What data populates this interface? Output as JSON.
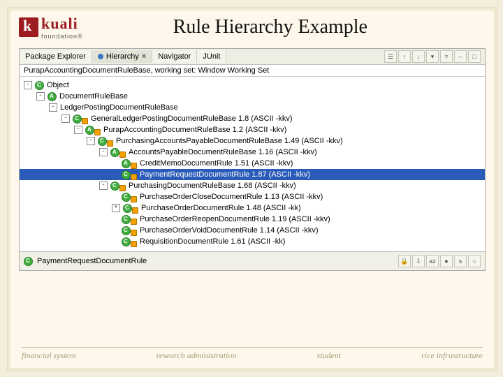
{
  "logo": {
    "word": "kuali",
    "sub": "foundation®"
  },
  "title": "Rule Hierarchy Example",
  "tabs": {
    "items": [
      {
        "label": "Package Explorer",
        "active": false,
        "closable": false
      },
      {
        "label": "Hierarchy",
        "active": true,
        "closable": true
      },
      {
        "label": "Navigator",
        "active": false,
        "closable": false
      },
      {
        "label": "JUnit",
        "active": false,
        "closable": false
      }
    ]
  },
  "path": "PurapAccountingDocumentRuleBase, working set: Window Working Set",
  "tree": [
    {
      "indent": 0,
      "exp": "-",
      "icon": "cls",
      "label": "Object"
    },
    {
      "indent": 1,
      "exp": "-",
      "icon": "clsA",
      "label": "DocumentRuleBase"
    },
    {
      "indent": 2,
      "exp": "-",
      "icon": "none",
      "label": "LedgerPostingDocumentRuleBase"
    },
    {
      "indent": 3,
      "exp": "-",
      "icon": "ov",
      "label": "GeneralLedgerPostingDocumentRuleBase  1.8  (ASCII -kkv)"
    },
    {
      "indent": 4,
      "exp": "-",
      "icon": "clsAov",
      "label": "PurapAccountingDocumentRuleBase  1.2  (ASCII -kkv)"
    },
    {
      "indent": 5,
      "exp": "-",
      "icon": "ov",
      "label": "PurchasingAccountsPayableDocumentRuleBase  1.49  (ASCII -kkv)"
    },
    {
      "indent": 6,
      "exp": "-",
      "icon": "clsAov",
      "label": "AccountsPayableDocumentRuleBase  1.16  (ASCII -kkv)"
    },
    {
      "indent": 7,
      "exp": " ",
      "icon": "clsAov",
      "label": "CreditMemoDocumentRule  1.51  (ASCII -kkv)"
    },
    {
      "indent": 7,
      "exp": " ",
      "icon": "ov",
      "label": "PaymentRequestDocumentRule  1.87  (ASCII -kkv)",
      "selected": true
    },
    {
      "indent": 6,
      "exp": "-",
      "icon": "ov",
      "label": "PurchasingDocumentRuleBase  1.68  (ASCII -kkv)"
    },
    {
      "indent": 7,
      "exp": " ",
      "icon": "ov",
      "label": "PurchaseOrderCloseDocumentRule  1.13  (ASCII -kkv)"
    },
    {
      "indent": 7,
      "exp": "+",
      "icon": "ov",
      "label": "PurchaseOrderDocumentRule  1.48  (ASCII -kk)"
    },
    {
      "indent": 7,
      "exp": " ",
      "icon": "ov",
      "label": "PurchaseOrderReopenDocumentRule  1.19  (ASCII -kkv)"
    },
    {
      "indent": 7,
      "exp": " ",
      "icon": "ov",
      "label": "PurchaseOrderVoidDocumentRule  1.14  (ASCII -kkv)"
    },
    {
      "indent": 7,
      "exp": " ",
      "icon": "ov",
      "label": "RequisitionDocumentRule  1.61  (ASCII -kk)"
    }
  ],
  "selected_summary": "PaymentRequestDocumentRule",
  "footer": {
    "c1": "financial system",
    "c2": "research administration",
    "c3": "student",
    "c4": "rice infrastructure"
  }
}
